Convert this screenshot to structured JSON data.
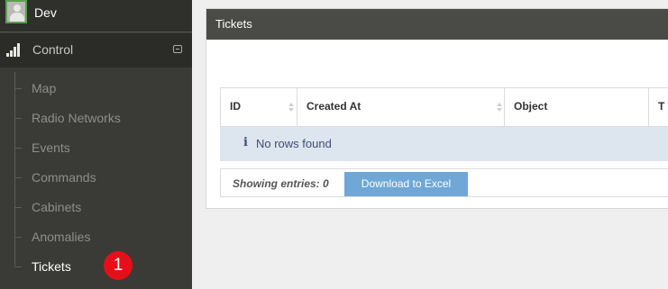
{
  "sidebar": {
    "user": {
      "name": "Dev"
    },
    "section": {
      "label": "Control",
      "icon": "signal-bars-icon",
      "toggle_icon": "collapse-icon"
    },
    "items": [
      {
        "label": "Map"
      },
      {
        "label": "Radio Networks"
      },
      {
        "label": "Events"
      },
      {
        "label": "Commands"
      },
      {
        "label": "Cabinets"
      },
      {
        "label": "Anomalies"
      },
      {
        "label": "Tickets",
        "active": true
      }
    ],
    "badge": "1"
  },
  "panel": {
    "title": "Tickets",
    "table": {
      "columns": [
        "ID",
        "Created At",
        "Object",
        "T"
      ],
      "empty_message": "No rows found",
      "info_icon": "i"
    },
    "footer": {
      "count_text": "Showing entries: 0",
      "download_label": "Download to Excel"
    }
  },
  "colors": {
    "sidebar_bg": "#3a3a36",
    "panel_header_bg": "#4a4a47",
    "badge": "#e3101a",
    "button": "#6fa7d6",
    "empty_row_bg": "#dde5ee"
  }
}
